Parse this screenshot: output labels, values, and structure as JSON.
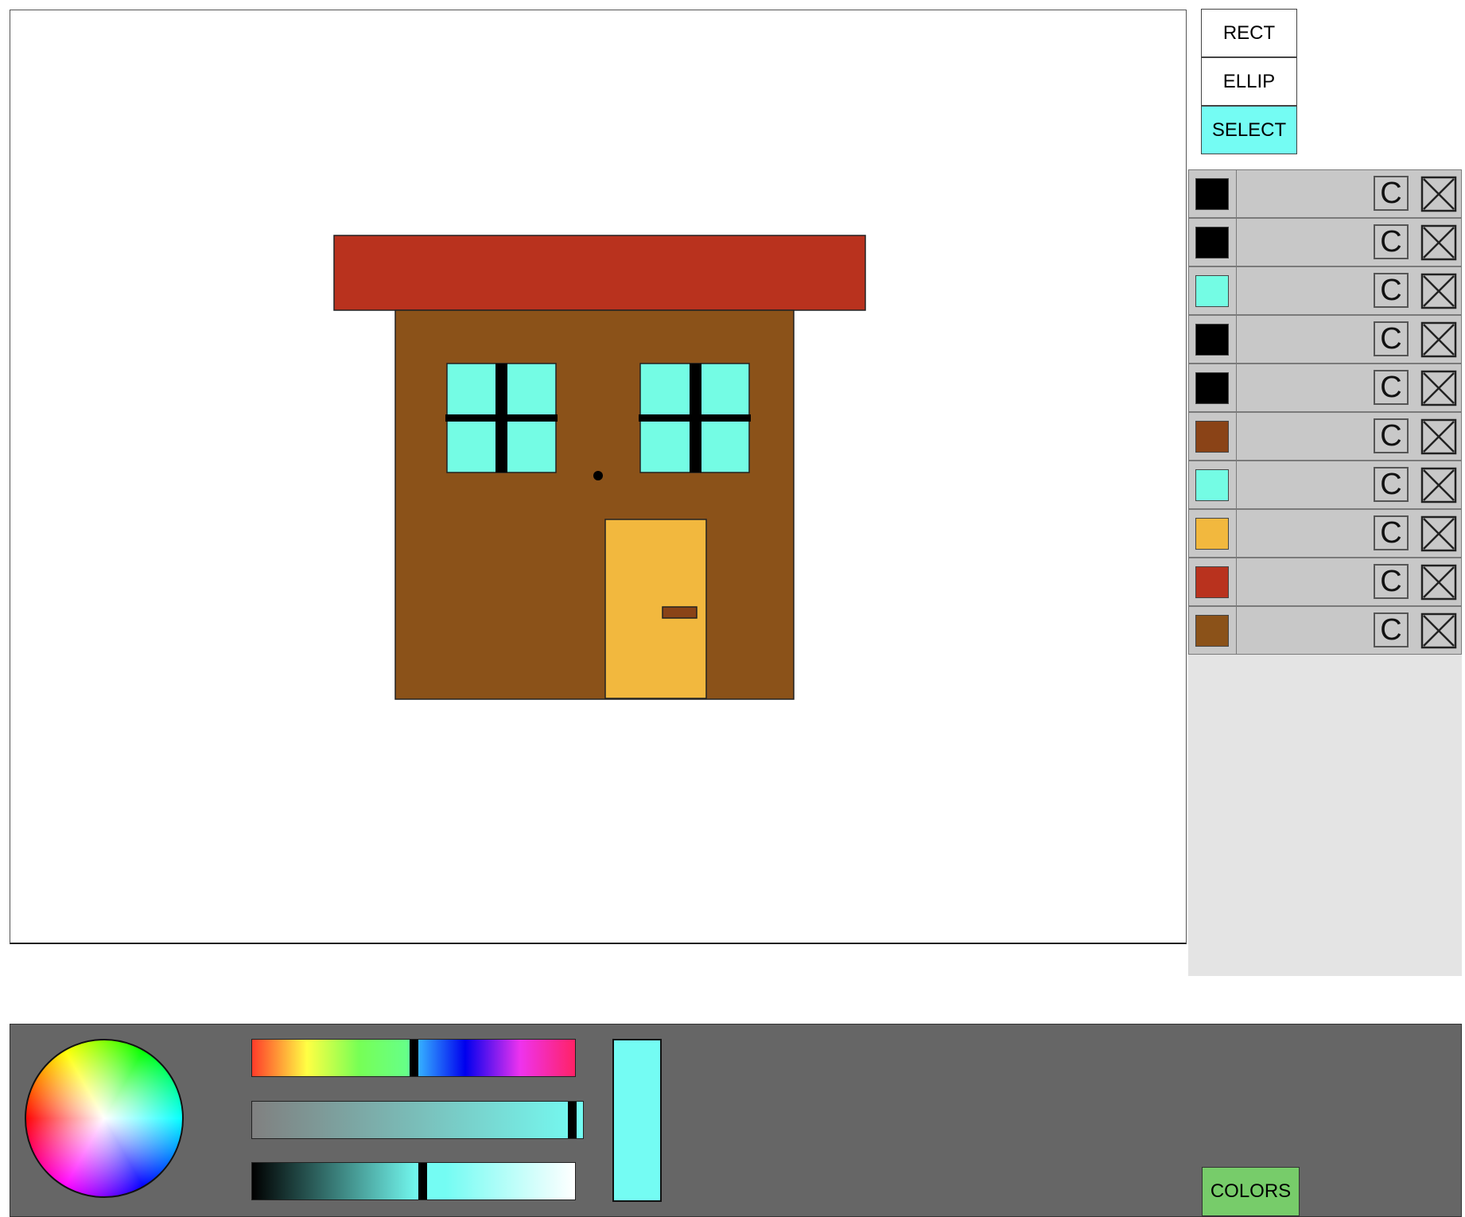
{
  "tools": {
    "rect_label": "RECT",
    "ellipse_label": "ELLIP",
    "select_label": "SELECT",
    "active_tool": "SELECT",
    "active_color": "#74fcf3"
  },
  "layers": [
    {
      "color": "#000000",
      "copy_label": "C",
      "delete_icon": "close-x-icon"
    },
    {
      "color": "#000000",
      "copy_label": "C",
      "delete_icon": "close-x-icon"
    },
    {
      "color": "#74fce4",
      "copy_label": "C",
      "delete_icon": "close-x-icon"
    },
    {
      "color": "#000000",
      "copy_label": "C",
      "delete_icon": "close-x-icon"
    },
    {
      "color": "#000000",
      "copy_label": "C",
      "delete_icon": "close-x-icon"
    },
    {
      "color": "#8a4317",
      "copy_label": "C",
      "delete_icon": "close-x-icon"
    },
    {
      "color": "#74fce4",
      "copy_label": "C",
      "delete_icon": "close-x-icon"
    },
    {
      "color": "#f2b83e",
      "copy_label": "C",
      "delete_icon": "close-x-icon"
    },
    {
      "color": "#b9321e",
      "copy_label": "C",
      "delete_icon": "close-x-icon"
    },
    {
      "color": "#8b5219",
      "copy_label": "C",
      "delete_icon": "close-x-icon"
    }
  ],
  "drawing": {
    "roof_color": "#b9321e",
    "wall_color": "#8b5219",
    "window_color": "#74fce4",
    "door_color": "#f2b83e",
    "door_handle_color": "#8a4317",
    "mullion_color": "#000000"
  },
  "color_picker": {
    "hue_position": 0.5,
    "saturation_position": 0.98,
    "value_position": 0.53,
    "preview_color": "#74fcf3"
  },
  "bottom": {
    "colors_label": "COLORS"
  }
}
